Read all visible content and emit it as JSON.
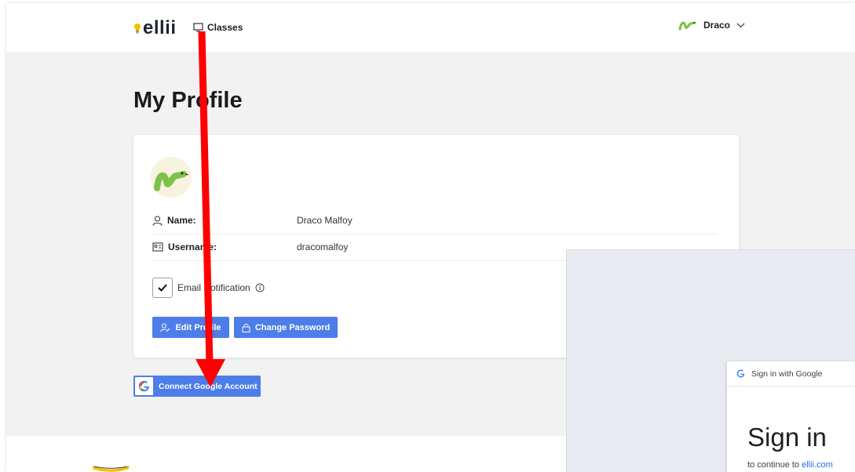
{
  "header": {
    "logo_text": "ellii",
    "nav_classes_label": "Classes",
    "user_name": "Draco"
  },
  "page": {
    "title": "My Profile"
  },
  "profile": {
    "name_label": "Name:",
    "name_value": "Draco Malfoy",
    "username_label": "Username:",
    "username_value": "dracomalfoy",
    "email_notification_label": "Email Notification",
    "email_notification_checked": true,
    "edit_profile_label": "Edit Profile",
    "change_password_label": "Change Password"
  },
  "google_connect": {
    "label": "Connect Google Account"
  },
  "google_signin": {
    "header_label": "Sign in with Google",
    "title": "Sign in",
    "subtitle_prefix": "to continue to ",
    "subtitle_link": "ellii.com"
  },
  "colors": {
    "primary_button": "#4d7de8",
    "avatar_snake": "#7cc24a",
    "annotation_arrow": "#ff0000",
    "logo_bulb": "#f2c200",
    "google_link": "#1a73e8"
  },
  "icons": {
    "logo": "lightbulb-icon",
    "classes": "board-icon",
    "user_avatar": "snake-icon",
    "dropdown": "chevron-down-icon",
    "name": "person-icon",
    "username": "id-card-icon",
    "checkbox": "checkmark-icon",
    "info": "info-icon",
    "edit_profile": "user-edit-icon",
    "change_password": "lock-icon",
    "google": "google-g-icon",
    "annotation": "red-arrow-down"
  }
}
